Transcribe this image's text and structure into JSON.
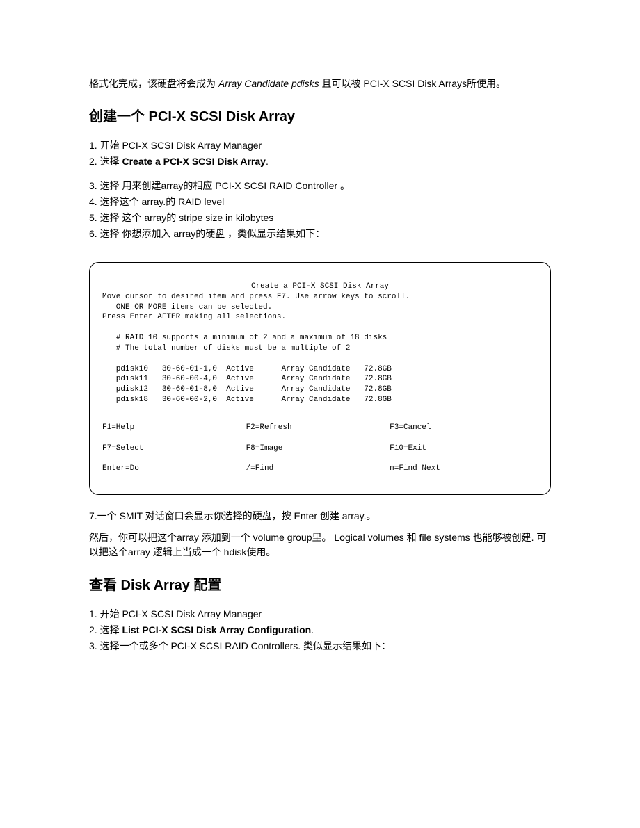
{
  "intro": {
    "pre": "格式化完成，该硬盘将会成为 ",
    "italic": "Array Candidate pdisks",
    "post": " 且可以被 PCI-X SCSI Disk Arrays所使用。"
  },
  "section1": {
    "title": "创建一个 PCI-X SCSI Disk Array",
    "steps_a": [
      "1. 开始 PCI-X SCSI Disk Array Manager",
      {
        "pre": "2. 选择 ",
        "bold": "Create a PCI-X SCSI Disk Array",
        "post": "."
      }
    ],
    "steps_b": [
      "3. 选择 用来创建array的相应 PCI-X SCSI RAID Controller 。",
      "4. 选择这个 array.的 RAID level",
      "5. 选择 这个 array的 stripe size in kilobytes",
      "6. 选择 你想添加入 array的硬盘 ，类似显示结果如下："
    ],
    "step7": "7.一个 SMIT 对话窗口会显示你选择的硬盘，按 Enter 创建 array.。",
    "after": "然后，你可以把这个array 添加到一个 volume group里。 Logical volumes 和 file systems 也能够被创建. 可以把这个array 逻辑上当成一个 hdisk使用。"
  },
  "terminal": {
    "title": "Create a PCI-X SCSI Disk Array",
    "line1": "Move cursor to desired item and press F7. Use arrow keys to scroll.",
    "line2": "   ONE OR MORE items can be selected.",
    "line3": "Press Enter AFTER making all selections.",
    "note1": "   # RAID 10 supports a minimum of 2 and a maximum of 18 disks",
    "note2": "   # The total number of disks must be a multiple of 2",
    "rows": [
      "   pdisk10   30-60-01-1,0  Active      Array Candidate   72.8GB",
      "   pdisk11   30-60-00-4,0  Active      Array Candidate   72.8GB",
      "   pdisk12   30-60-01-8,0  Active      Array Candidate   72.8GB",
      "   pdisk18   30-60-00-2,0  Active      Array Candidate   72.8GB"
    ],
    "footer": {
      "r1c1": "F1=Help",
      "r1c2": "F2=Refresh",
      "r1c3": "F3=Cancel",
      "r2c1": "F7=Select",
      "r2c2": "F8=Image",
      "r2c3": "F10=Exit",
      "r3c1": "Enter=Do",
      "r3c2": "/=Find",
      "r3c3": "n=Find Next"
    }
  },
  "section2": {
    "title": "查看 Disk Array 配置",
    "steps": [
      "1. 开始 PCI-X SCSI Disk Array Manager",
      {
        "pre": "2. 选择 ",
        "bold": "List PCI-X SCSI Disk Array Configuration",
        "post": "."
      },
      "3. 选择一个或多个 PCI-X SCSI RAID Controllers. 类似显示结果如下："
    ]
  }
}
